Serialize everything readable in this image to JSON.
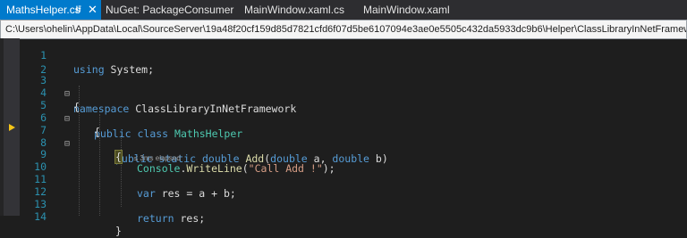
{
  "tabs": [
    {
      "label": "MathsHelper.cs",
      "active": true,
      "pin_icon": "pin-icon",
      "close_icon": "close-icon"
    },
    {
      "label": "NuGet: PackageConsumer",
      "active": false
    },
    {
      "label": "MainWindow.xaml.cs",
      "active": false
    },
    {
      "label": "MainWindow.xaml",
      "active": false
    }
  ],
  "file_path": "C:\\Users\\ohelin\\AppData\\Local\\SourceServer\\19a48f20cf159d85d7821cfd6f07d5be6107094e3ae0e5505c432da5933dc9b6\\Helper\\ClassLibraryInNetFramework\\MathsHelper.cs",
  "colors": {
    "accent": "#007acc",
    "keyword": "#569cd6",
    "type": "#4ec9b0",
    "method": "#dcdcaa",
    "string": "#d69d85",
    "line_number": "#2b91af",
    "breakpoint_arrow": "#f5c518"
  },
  "editor": {
    "execution_arrow_icon": "current-statement-arrow-icon",
    "lines": [
      {
        "num": "1",
        "text": "using System;"
      },
      {
        "num": "2",
        "text": ""
      },
      {
        "num": "3",
        "text": "namespace ClassLibraryInNetFramework"
      },
      {
        "num": "4",
        "text": "{"
      },
      {
        "num": "5",
        "text": "public class MathsHelper"
      },
      {
        "num": "6",
        "text": "{"
      },
      {
        "num": "7",
        "text": "public static double Add(double a, double b)"
      },
      {
        "num": "8",
        "text": "{",
        "hint": "≤ 3ms elapsed"
      },
      {
        "num": "9",
        "text": "Console.WriteLine(\"Call Add !\");"
      },
      {
        "num": "10",
        "text": ""
      },
      {
        "num": "11",
        "text": "var res = a + b;"
      },
      {
        "num": "12",
        "text": ""
      },
      {
        "num": "13",
        "text": "return res;"
      },
      {
        "num": "14",
        "text": "}"
      }
    ]
  }
}
